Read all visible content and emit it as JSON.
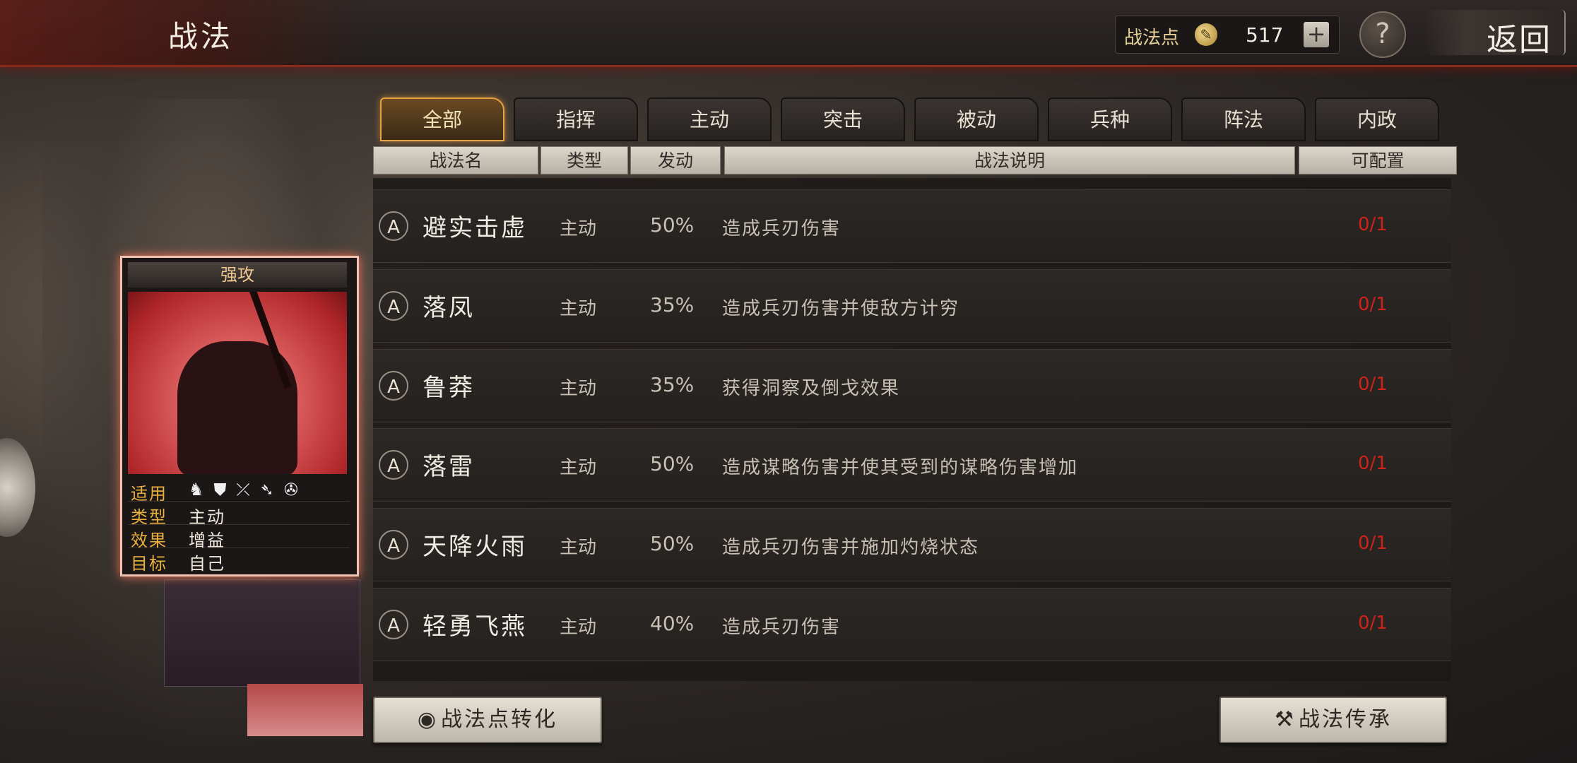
{
  "header": {
    "title": "战法",
    "points_label": "战法点",
    "points_value": "517",
    "plus": "+",
    "help": "?",
    "back": "返回"
  },
  "tabs": [
    {
      "label": "全部",
      "active": true
    },
    {
      "label": "指挥",
      "active": false
    },
    {
      "label": "主动",
      "active": false
    },
    {
      "label": "突击",
      "active": false
    },
    {
      "label": "被动",
      "active": false
    },
    {
      "label": "兵种",
      "active": false
    },
    {
      "label": "阵法",
      "active": false
    },
    {
      "label": "内政",
      "active": false
    }
  ],
  "columns": {
    "name": "战法名",
    "type": "类型",
    "trigger": "发动",
    "desc": "战法说明",
    "config": "可配置"
  },
  "rows": [
    {
      "grade": "A",
      "name": "避实击虚",
      "type": "主动",
      "pct": "50%",
      "desc": "造成兵刃伤害",
      "config": "0/1"
    },
    {
      "grade": "A",
      "name": "落凤",
      "type": "主动",
      "pct": "35%",
      "desc": "造成兵刃伤害并使敌方计穷",
      "config": "0/1"
    },
    {
      "grade": "A",
      "name": "鲁莽",
      "type": "主动",
      "pct": "35%",
      "desc": "获得洞察及倒戈效果",
      "config": "0/1"
    },
    {
      "grade": "A",
      "name": "落雷",
      "type": "主动",
      "pct": "50%",
      "desc": "造成谋略伤害并使其受到的谋略伤害增加",
      "config": "0/1"
    },
    {
      "grade": "A",
      "name": "天降火雨",
      "type": "主动",
      "pct": "50%",
      "desc": "造成兵刃伤害并施加灼烧状态",
      "config": "0/1"
    },
    {
      "grade": "A",
      "name": "轻勇飞燕",
      "type": "主动",
      "pct": "40%",
      "desc": "造成兵刃伤害",
      "config": "0/1"
    }
  ],
  "card": {
    "title": "强攻",
    "apply_key": "适用",
    "type_key": "类型",
    "type_val": "主动",
    "effect_key": "效果",
    "effect_val": "增益",
    "target_key": "目标",
    "target_val": "自己",
    "apply_icons": [
      "cavalry-icon",
      "shield-icon",
      "bow-icon",
      "spear-icon",
      "wheel-icon"
    ]
  },
  "buttons": {
    "convert": "战法点转化",
    "inherit": "战法传承"
  },
  "colors": {
    "accent_red": "#d0221a",
    "tab_active_border": "#e8a240",
    "card_glow": "#f2c2b0"
  }
}
